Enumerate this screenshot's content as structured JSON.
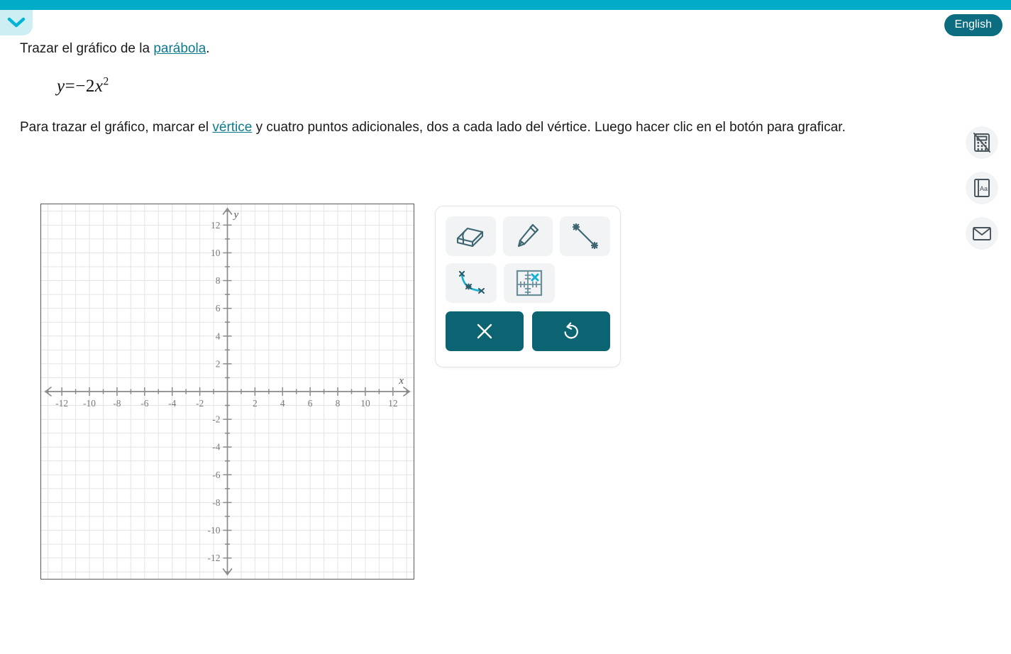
{
  "header": {
    "bar_color": "#00acc8",
    "cut_off_text": "",
    "collapse_icon": "chevron-down-icon",
    "language_label": "English"
  },
  "problem": {
    "prompt_before_link": "Trazar el gráfico de la ",
    "prompt_link": "parábola",
    "prompt_after_link": ".",
    "equation": {
      "lhs": "y",
      "equals": "=",
      "sign": "−",
      "coefficient": "2",
      "variable": "x",
      "exponent": "2",
      "plain": "y = − 2x²"
    },
    "instructions_part1": "Para trazar el gráfico, marcar el ",
    "instructions_link": "vértice",
    "instructions_part2": " y cuatro puntos adicionales, dos a cada lado del vértice. Luego hacer clic en el botón para graficar."
  },
  "chart_data": {
    "type": "scatter",
    "title": "",
    "xlabel": "x",
    "ylabel": "y",
    "xlim": [
      -13.5,
      13.5
    ],
    "ylim": [
      -13.5,
      13.5
    ],
    "grid": true,
    "grid_step": 1,
    "tick_step": 2,
    "x_ticks": [
      -12,
      -10,
      -8,
      -6,
      -4,
      -2,
      2,
      4,
      6,
      8,
      10,
      12
    ],
    "y_ticks": [
      12,
      10,
      8,
      6,
      4,
      2,
      -2,
      -4,
      -6,
      -8,
      -10,
      -12
    ],
    "x_tick_labels": [
      "-12",
      "-10",
      "-8",
      "-6",
      "-4",
      "-2",
      "2",
      "4",
      "6",
      "8",
      "10",
      "12"
    ],
    "y_tick_labels": [
      "12",
      "10",
      "8",
      "6",
      "4",
      "2",
      "-2",
      "-4",
      "-6",
      "-8",
      "-10",
      "-12"
    ],
    "series": [
      {
        "name": "plotted-points",
        "x": [],
        "y": []
      }
    ],
    "annotations": [],
    "axis_color": "#8a8a8a",
    "grid_color": "#e4e4e4",
    "border_color": "#5a5a5a"
  },
  "palette": {
    "tools": [
      {
        "id": "eraser",
        "icon": "eraser-icon",
        "label": "Borrador",
        "selected": false
      },
      {
        "id": "pencil",
        "icon": "pencil-icon",
        "label": "Lápiz",
        "selected": false
      },
      {
        "id": "line",
        "icon": "line-segment-icon",
        "label": "Recta",
        "selected": false
      },
      {
        "id": "curve",
        "icon": "parabola-curve-icon",
        "label": "Curva",
        "selected": true
      },
      {
        "id": "plot-point",
        "icon": "plot-point-grid-icon",
        "label": "Marcar punto",
        "selected": false
      }
    ],
    "actions": [
      {
        "id": "clear",
        "icon": "close-x-icon",
        "label": "Borrar todo",
        "color": "#0c6473"
      },
      {
        "id": "undo",
        "icon": "undo-arrow-icon",
        "label": "Deshacer",
        "color": "#0c6473"
      }
    ]
  },
  "right_rail": {
    "items": [
      {
        "id": "calculator",
        "icon": "calculator-disabled-icon",
        "label": "Calculadora no permitida"
      },
      {
        "id": "glossary",
        "icon": "glossary-aa-icon",
        "label": "Glosario"
      },
      {
        "id": "message",
        "icon": "envelope-icon",
        "label": "Mensaje"
      }
    ]
  },
  "colors": {
    "brand_cyan": "#00acc8",
    "brand_teal": "#0c6473",
    "link": "#0d7a8c",
    "icon_slate": "#3d6672",
    "accent_cyan": "#16b0d4",
    "tool_bg": "#f1f3f4"
  }
}
